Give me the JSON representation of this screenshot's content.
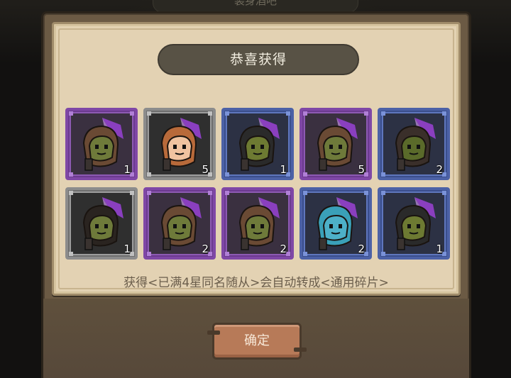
{
  "background": {
    "top_tab_label": "装身酒吧"
  },
  "dialog": {
    "title": "恭喜获得",
    "notice": "获得<已满4星同名随从>会自动转成<通用碎片>",
    "confirm_label": "确定"
  },
  "rewards": [
    {
      "rarity": "purple",
      "hood": "#6a4a34",
      "skin": "#6e7a3a",
      "count": "1"
    },
    {
      "rarity": "gray",
      "hood": "#b86a3a",
      "skin": "#f0c3a0",
      "count": "5"
    },
    {
      "rarity": "blue",
      "hood": "#2a2a2a",
      "skin": "#6d7a32",
      "count": "1"
    },
    {
      "rarity": "purple",
      "hood": "#6a4a34",
      "skin": "#6e7a3a",
      "count": "5"
    },
    {
      "rarity": "blue",
      "hood": "#3a2f2a",
      "skin": "#5a6a2a",
      "count": "2"
    },
    {
      "rarity": "gray",
      "hood": "#2a2420",
      "skin": "#6e7a3a",
      "count": "1"
    },
    {
      "rarity": "purple",
      "hood": "#6a4a34",
      "skin": "#6e7a3a",
      "count": "2"
    },
    {
      "rarity": "purple",
      "hood": "#6a4a34",
      "skin": "#6e7a3a",
      "count": "2"
    },
    {
      "rarity": "blue",
      "hood": "#3aa0b8",
      "skin": "#4db0c8",
      "count": "2"
    },
    {
      "rarity": "blue",
      "hood": "#2a2a2a",
      "skin": "#6d7a32",
      "count": "1"
    }
  ],
  "colors": {
    "purple": "#7f47a6",
    "gray": "#8c8c8c",
    "blue": "#4c61a6",
    "gem": "#8a3fbf"
  }
}
